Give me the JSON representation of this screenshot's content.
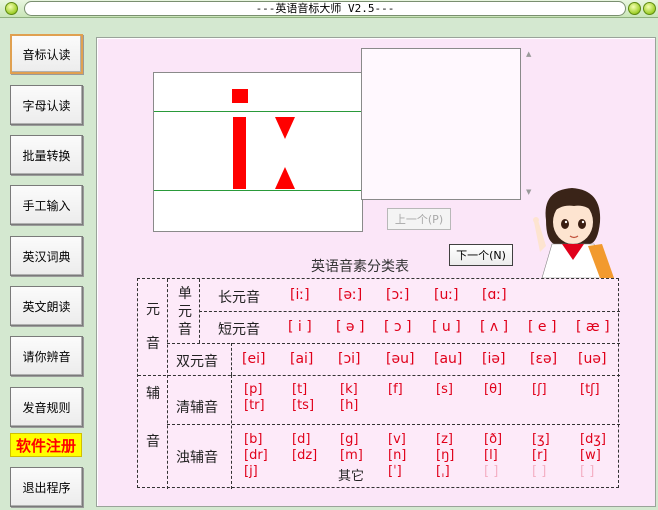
{
  "window": {
    "title": "---英语音标大师 V2.5---"
  },
  "sidebar": {
    "items": [
      {
        "label": "音标认读"
      },
      {
        "label": "字母认读"
      },
      {
        "label": "批量转换"
      },
      {
        "label": "手工输入"
      },
      {
        "label": "英汉词典"
      },
      {
        "label": "英文朗读"
      },
      {
        "label": "请你辨音"
      },
      {
        "label": "发音规则"
      },
      {
        "label": "软件注册"
      },
      {
        "label": "退出程序"
      }
    ]
  },
  "display": {
    "symbol": "iː"
  },
  "nav": {
    "prev_label": "上一个(P)",
    "next_label": "下一个(N)"
  },
  "table": {
    "title": "英语音素分类表",
    "vowel_label_1": "元",
    "vowel_label_2": "音",
    "single_1": "单",
    "single_2": "元",
    "single_3": "音",
    "long_label": "长元音",
    "short_label": "短元音",
    "diph_label": "双元音",
    "cons_label_1": "辅",
    "cons_label_2": "音",
    "voiceless_label": "清辅音",
    "voiced_label": "浊辅音",
    "other_label": "其它",
    "long": [
      "[iː]",
      "[əː]",
      "[ɔː]",
      "[uː]",
      "[ɑː]"
    ],
    "short": [
      "[ i ]",
      "[ ə ]",
      "[ ɔ ]",
      "[ u ]",
      "[ ʌ ]",
      "[ e ]",
      "[ æ ]"
    ],
    "diph": [
      "[ei]",
      "[ai]",
      "[ɔi]",
      "[əu]",
      "[au]",
      "[iə]",
      "[εə]",
      "[uə]"
    ],
    "voiceless_r1": [
      "[p]",
      "[t]",
      "[k]",
      "[f]",
      "[s]",
      "[θ]",
      "[ʃ]",
      "[tʃ]"
    ],
    "voiceless_r2": [
      "[tr]",
      "[ts]",
      "[h]"
    ],
    "voiced_r1": [
      "[b]",
      "[d]",
      "[g]",
      "[v]",
      "[z]",
      "[ð]",
      "[ʒ]",
      "[dʒ]"
    ],
    "voiced_r2": [
      "[dr]",
      "[dz]",
      "[m]",
      "[n]",
      "[ŋ]",
      "[l]",
      "[r]",
      "[w]"
    ],
    "voiced_r3": [
      "[j]"
    ],
    "other": [
      "[ˈ]",
      "[ˌ]",
      "[ ]",
      "[ ]",
      "[ ]"
    ]
  },
  "colors": {
    "accent": "#e0001a",
    "panel": "#fbe6f8",
    "register_bg": "#ffff00"
  }
}
